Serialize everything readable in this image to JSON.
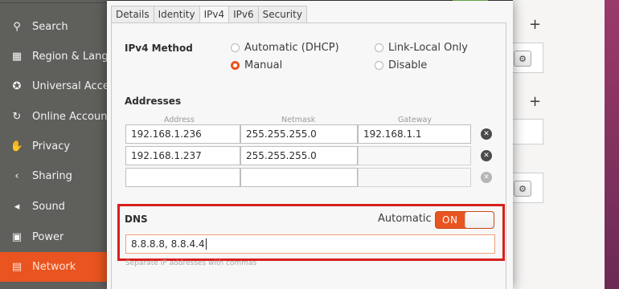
{
  "sidebar": {
    "items": [
      {
        "label": "Search",
        "icon": "search-icon",
        "glyph": "⚲"
      },
      {
        "label": "Region & Language",
        "icon": "keyboard-icon",
        "glyph": "▦"
      },
      {
        "label": "Universal Access",
        "icon": "accessibility-icon",
        "glyph": "✪"
      },
      {
        "label": "Online Accounts",
        "icon": "online-accounts-icon",
        "glyph": "↻"
      },
      {
        "label": "Privacy",
        "icon": "privacy-hand-icon",
        "glyph": "✋"
      },
      {
        "label": "Sharing",
        "icon": "share-icon",
        "glyph": "‹"
      },
      {
        "label": "Sound",
        "icon": "speaker-icon",
        "glyph": "◂"
      },
      {
        "label": "Power",
        "icon": "power-icon",
        "glyph": "▣"
      },
      {
        "label": "Network",
        "icon": "network-icon",
        "glyph": "▤"
      }
    ]
  },
  "dialog": {
    "tabs": [
      "Details",
      "Identity",
      "IPv4",
      "IPv6",
      "Security"
    ],
    "active_tab": "IPv4",
    "method": {
      "label": "IPv4 Method",
      "options": {
        "automatic": "Automatic (DHCP)",
        "manual": "Manual",
        "link_local": "Link-Local Only",
        "disable": "Disable"
      },
      "selected": "Manual"
    },
    "addresses": {
      "label": "Addresses",
      "headers": [
        "Address",
        "Netmask",
        "Gateway"
      ],
      "rows": [
        {
          "address": "192.168.1.236",
          "netmask": "255.255.255.0",
          "gateway": "192.168.1.1"
        },
        {
          "address": "192.168.1.237",
          "netmask": "255.255.255.0",
          "gateway": ""
        },
        {
          "address": "",
          "netmask": "",
          "gateway": ""
        }
      ],
      "delete_glyph": "✕"
    },
    "dns": {
      "label": "DNS",
      "automatic_label": "Automatic",
      "toggle_text": "ON",
      "value": "8.8.8.8, 8.8.4.4",
      "hint": "Separate IP addresses with commas"
    }
  },
  "background_right": {
    "plus": "+"
  },
  "colors": {
    "accent": "#e95420",
    "highlight_box": "#d81e1e"
  }
}
